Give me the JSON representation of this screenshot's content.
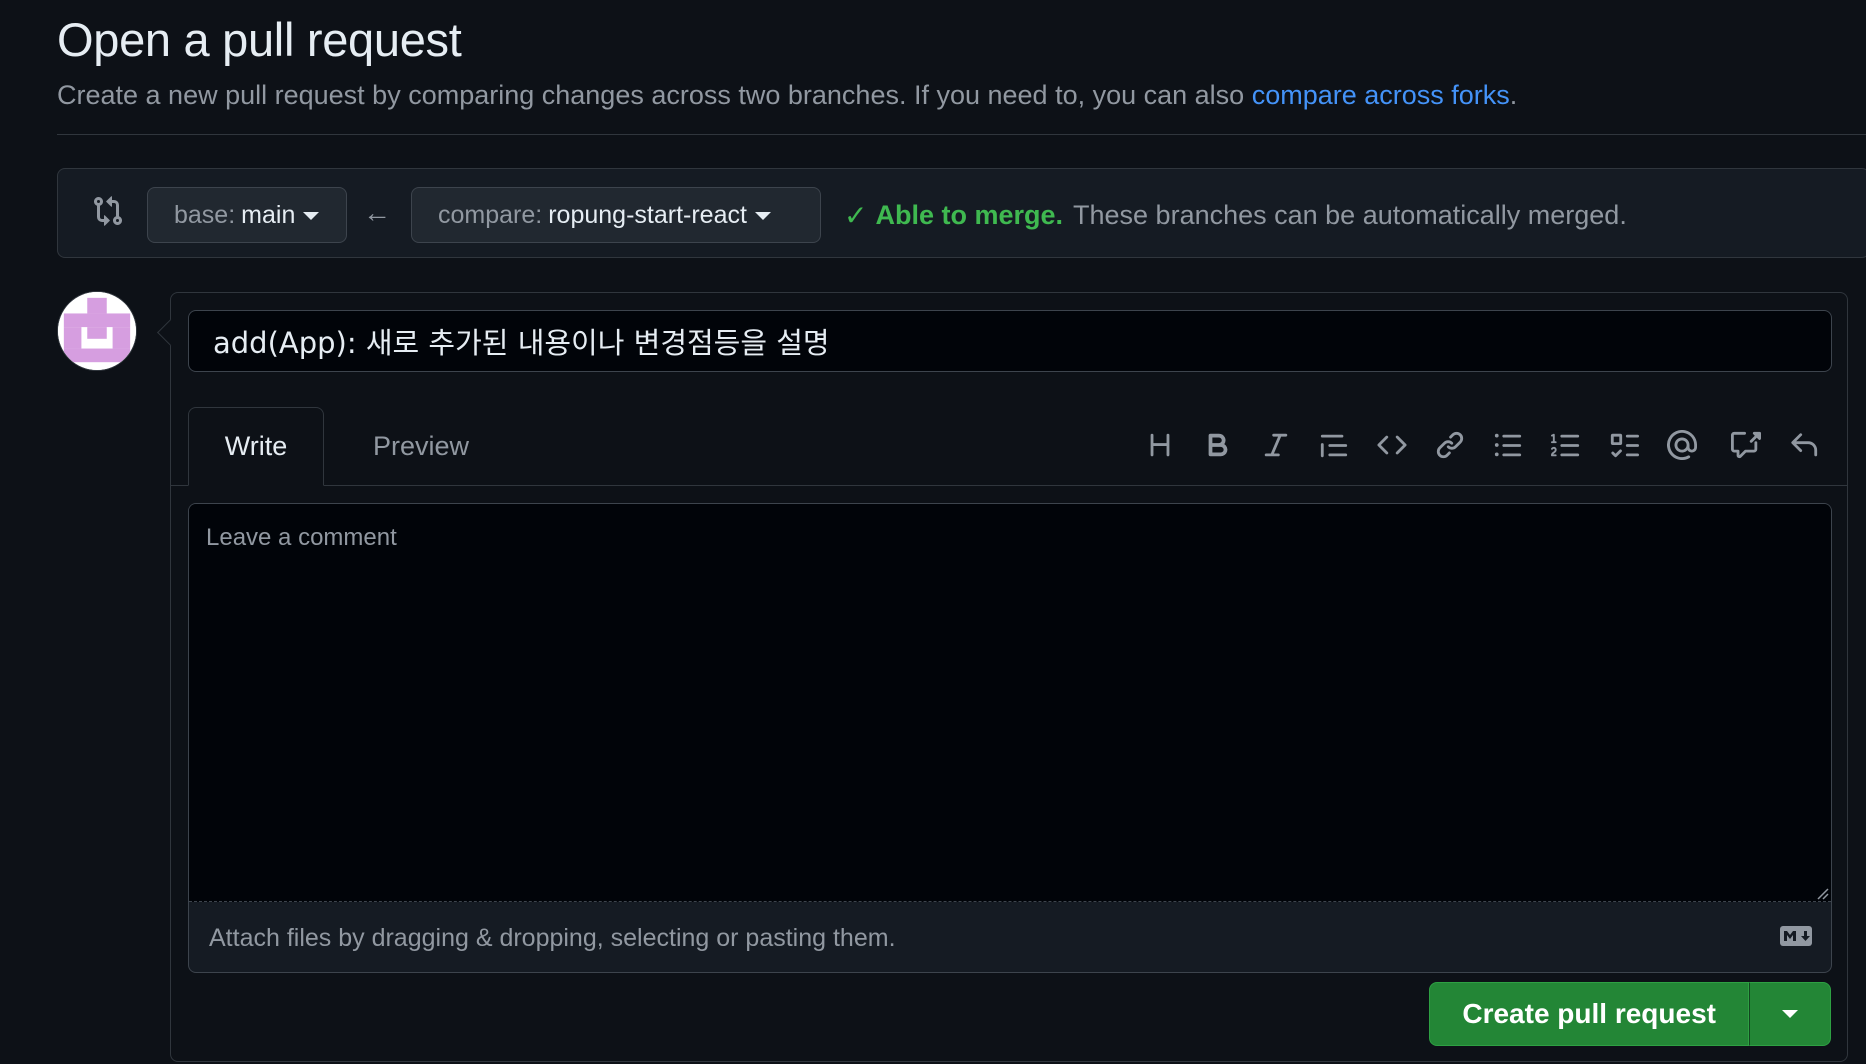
{
  "header": {
    "title": "Open a pull request",
    "subtitle_text": "Create a new pull request by comparing changes across two branches. If you need to, you can also ",
    "subtitle_link": "compare across forks",
    "subtitle_end": "."
  },
  "range": {
    "base_prefix": "base:",
    "base_branch": "main",
    "compare_prefix": "compare:",
    "compare_branch": "ropung-start-react",
    "arrow": "←",
    "merge_ok": "Able to merge.",
    "merge_text": "These branches can be automatically merged."
  },
  "form": {
    "title_value": "add(App): 새로 추가된 내용이나 변경점등을 설명",
    "tabs": {
      "write": "Write",
      "preview": "Preview"
    },
    "toolbar_icons": [
      "heading-icon",
      "bold-icon",
      "italic-icon",
      "quote-icon",
      "code-icon",
      "link-icon",
      "unordered-list-icon",
      "ordered-list-icon",
      "task-list-icon",
      "mention-icon",
      "reference-icon",
      "undo-icon"
    ],
    "comment_placeholder": "Leave a comment",
    "attach_text": "Attach files by dragging & dropping, selecting or pasting them.",
    "submit_label": "Create pull request"
  },
  "colors": {
    "background": "#0d1117",
    "accent_link": "#4493f8",
    "success": "#3fb950",
    "button_green": "#238636"
  }
}
